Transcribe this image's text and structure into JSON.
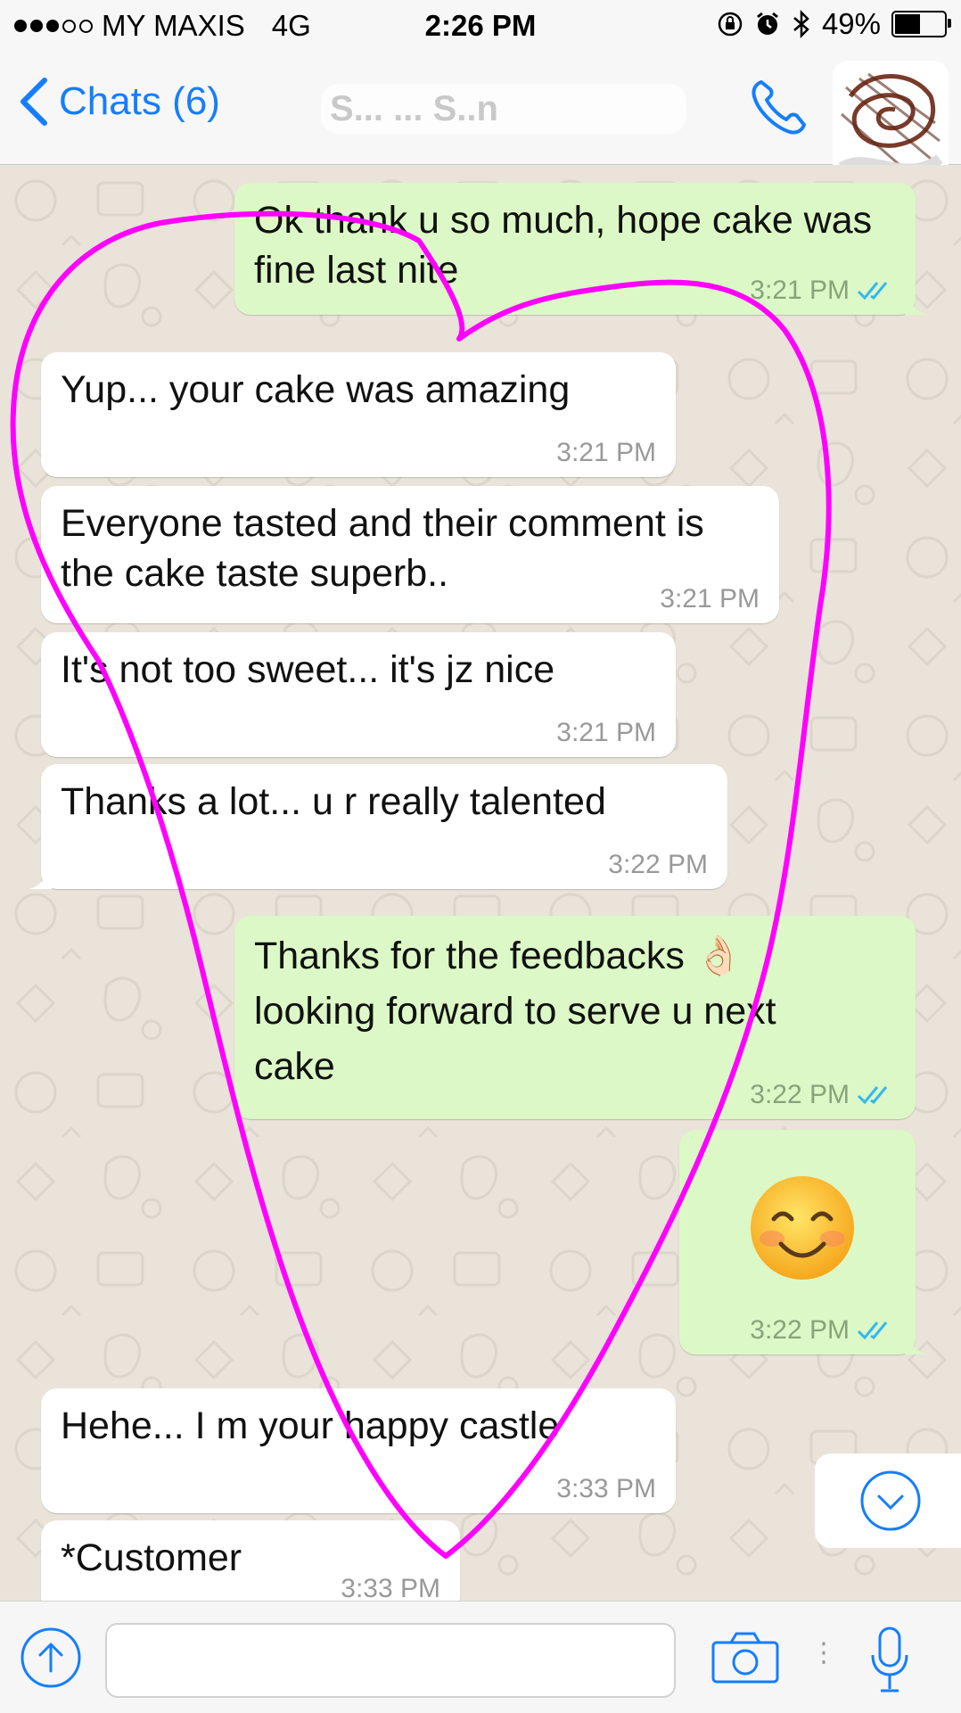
{
  "status_bar": {
    "carrier": "MY MAXIS",
    "network": "4G",
    "time": "2:26 PM",
    "battery": "49%",
    "battery_level": 0.49,
    "signal_bars": 3,
    "icons": [
      "orientation-lock-icon",
      "alarm-icon",
      "bluetooth-icon",
      "battery-icon"
    ]
  },
  "nav": {
    "back_label": "Chats (6)",
    "contact_name": "S... ... S..n",
    "call_icon": "phone-icon"
  },
  "messages": [
    {
      "direction": "out",
      "text": "Ok thank u so much, hope cake was fine last nite",
      "time": "3:21 PM",
      "read": true
    },
    {
      "direction": "in",
      "text": "Yup... your cake was amazing",
      "time": "3:21 PM"
    },
    {
      "direction": "in",
      "text": "Everyone tasted and their comment is the cake taste superb..",
      "time": "3:21 PM"
    },
    {
      "direction": "in",
      "text": "It's not too sweet... it's jz nice",
      "time": "3:21 PM"
    },
    {
      "direction": "in",
      "text": "Thanks a lot... u r really talented",
      "time": "3:22 PM"
    },
    {
      "direction": "out",
      "text": "Thanks for the feedbacks 👌🏻 looking forward to serve u next cake",
      "time": "3:22 PM",
      "read": true
    },
    {
      "direction": "out",
      "text": "😊",
      "time": "3:22 PM",
      "read": true,
      "emoji_only": true
    },
    {
      "direction": "in",
      "text": "Hehe... I m your happy castle",
      "time": "3:33 PM"
    },
    {
      "direction": "in",
      "text": "*Customer",
      "time": "3:33 PM"
    }
  ],
  "input_bar": {
    "placeholder": "",
    "icons": [
      "upload-icon",
      "camera-icon",
      "microphone-icon"
    ]
  },
  "colors": {
    "accent": "#157efb",
    "outgoing_bubble": "#dcf8c6",
    "incoming_bubble": "#ffffff",
    "wallpaper": "#e9e3da",
    "read_ticks": "#34b7f1",
    "annotation": "#ff00ff"
  }
}
